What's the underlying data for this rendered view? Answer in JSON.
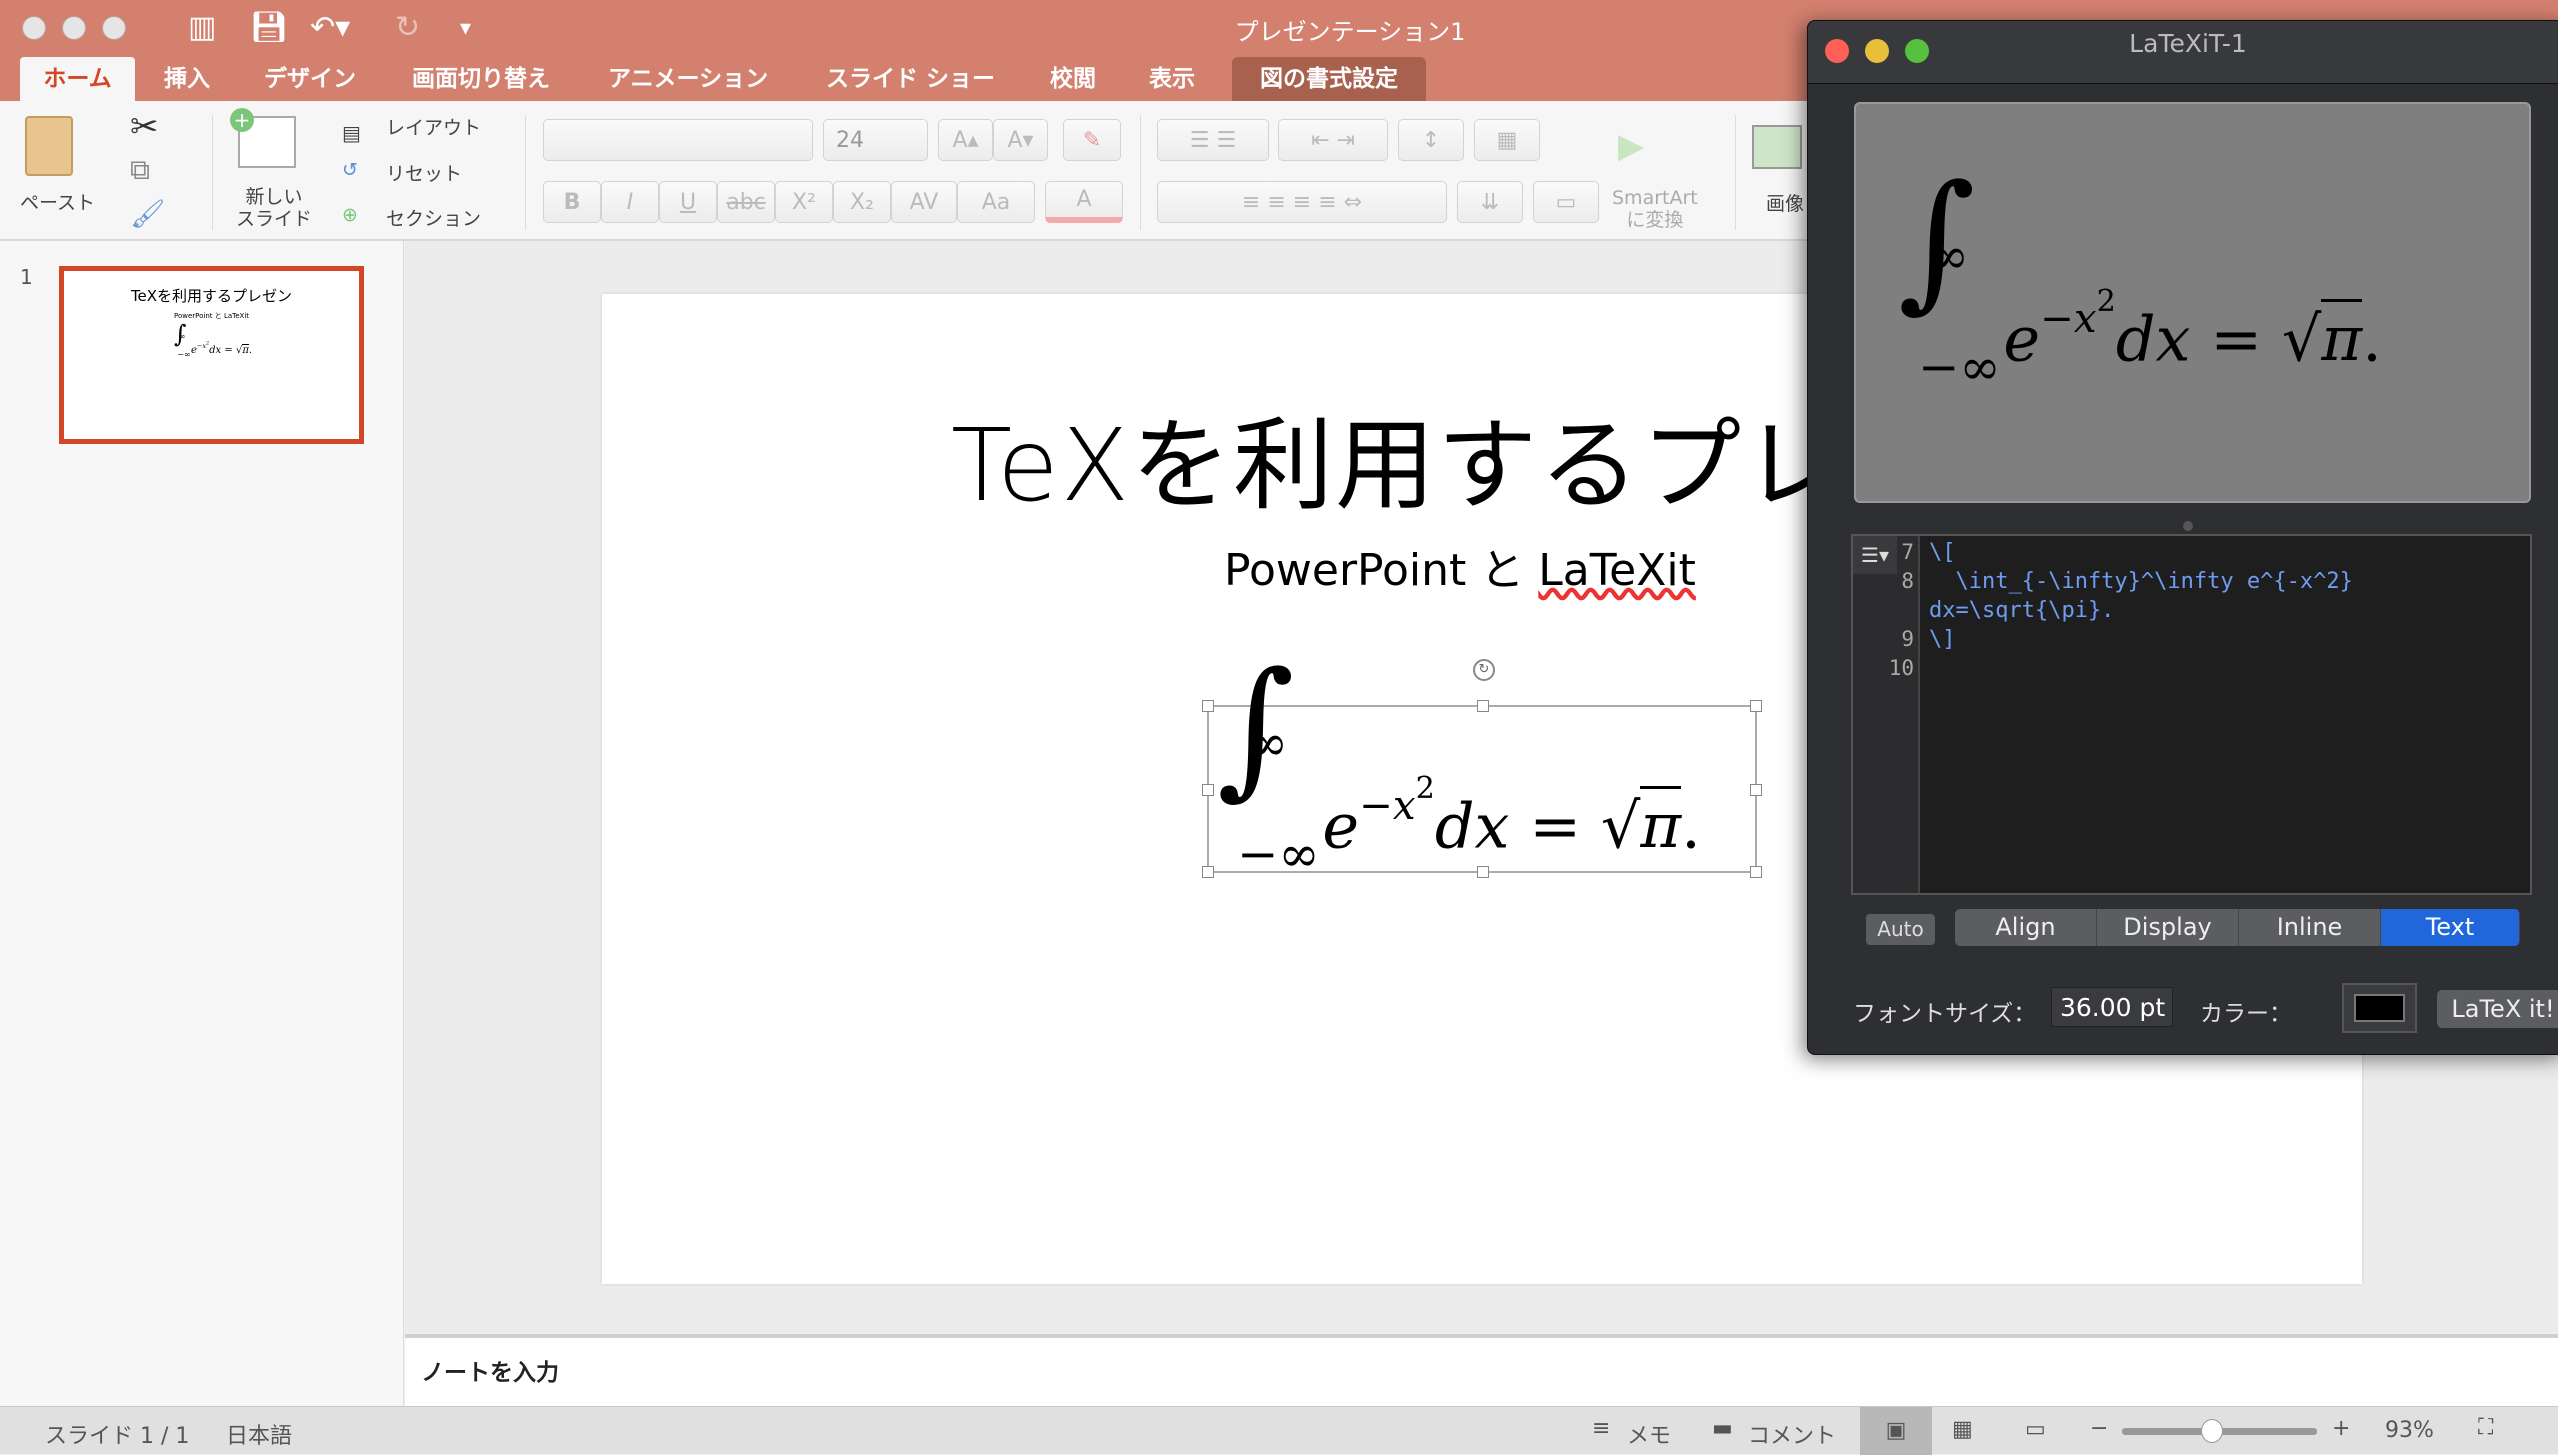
{
  "powerpoint": {
    "window_title": "プレゼンテーション1",
    "tabs": [
      "ホーム",
      "挿入",
      "デザイン",
      "画面切り替え",
      "アニメーション",
      "スライド ショー",
      "校閲",
      "表示",
      "図の書式設定"
    ],
    "active_tab": "ホーム",
    "ribbon": {
      "paste": "ペースト",
      "new_slide": "新しい\nスライド",
      "layout": "レイアウト",
      "reset": "リセット",
      "section": "セクション",
      "font_name": "",
      "font_size": "24",
      "bold": "B",
      "italic": "I",
      "underline": "U",
      "strike": "abc",
      "superscript": "X²",
      "subscript": "X₂",
      "spacing": "AV",
      "case": "Aa",
      "font_color": "A",
      "grow": "A▴",
      "shrink": "A▾",
      "smartart": "SmartArt\nに変換",
      "picture": "画像"
    },
    "thumbnail": {
      "number": "1",
      "title": "TeXを利用するプレゼン",
      "subtitle": "PowerPoint と LaTeXit"
    },
    "slide": {
      "title": "TeXを利用するプレゼン",
      "subtitle_a": "PowerPoint と ",
      "subtitle_b": "LaTeXit"
    },
    "notes_placeholder": "ノートを入力",
    "status": {
      "slide": "スライド 1 / 1",
      "language": "日本語",
      "notes": "メモ",
      "comments": "コメント",
      "zoom": "93%",
      "zoom_level": 93
    },
    "accent": "#d24726"
  },
  "equation": {
    "int": "∫",
    "upper": "∞",
    "lower": "−∞",
    "e": "e",
    "exp_minus": "−",
    "exp_x": "x",
    "exp_2": "2",
    "dx": "dx",
    "eq": " = ",
    "sqrt": "√",
    "pi": "π",
    "dot": "."
  },
  "latexit": {
    "window_title": "LaTeXiT-1",
    "line_numbers": [
      "7",
      "8",
      "9",
      "10"
    ],
    "code": [
      "\\[",
      "  \\int_{-\\infty}^\\infty e^{-x^2}",
      "dx=\\sqrt{\\pi}.",
      "\\]"
    ],
    "auto": "Auto",
    "modes": [
      "Align",
      "Display",
      "Inline",
      "Text"
    ],
    "active_mode": "Text",
    "font_size_label": "フォントサイズ：",
    "font_size": "36.00 pt",
    "color_label": "カラー：",
    "color": "#000000",
    "latex_button": "LaTeX it!",
    "accent": "#2067dc"
  }
}
